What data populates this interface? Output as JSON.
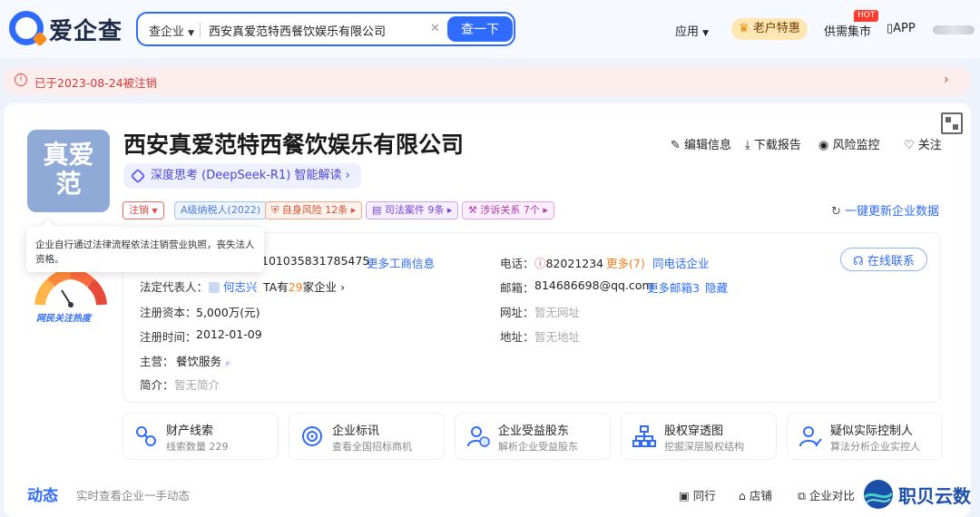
{
  "header": {
    "logo_text": "爱企查",
    "search_type": "查企业",
    "search_value": "西安真爱范特西餐饮娱乐有限公司",
    "search_button": "查一下",
    "nav": {
      "apps": "应用",
      "vip": "老户特惠",
      "market": "供需集市",
      "hot_badge": "HOT",
      "app": "APP"
    }
  },
  "notice": {
    "text": "已于2023-08-24被注销"
  },
  "company": {
    "logo_text": "真爱范",
    "name": "西安真爱范特西餐饮娱乐有限公司",
    "ai_label": "深度思考 (DeepSeek-R1) 智能解读",
    "actions": {
      "edit": "编辑信息",
      "download": "下载报告",
      "monitor": "风险监控",
      "follow": "关注"
    },
    "tags": {
      "status": "注销",
      "tax": "A级纳税人(2022)",
      "risk": "自身风险 12条",
      "judicial": "司法案件 9条",
      "litigation": "涉诉关系 7个"
    },
    "refresh": "一键更新企业数据",
    "tooltip": "企业自行通过法律流程依法注销营业执照，丧失法人资格。"
  },
  "info": {
    "credit_code_partial": "101035831785475",
    "more_business": "更多工商信息",
    "legal_label": "法定代表人：",
    "legal_name": "何志兴",
    "legal_has": "TA有",
    "legal_count": "29",
    "legal_suffix": "家企业",
    "capital_label": "注册资本：",
    "capital_value": "5,000万(元)",
    "date_label": "注册时间：",
    "date_value": "2012-01-09",
    "main_label": "主营：",
    "main_value": "餐饮服务",
    "intro_label": "简介：",
    "intro_value": "暂无简介",
    "phone_label": "电话：",
    "phone_value": "82021234",
    "phone_more": "更多(7)",
    "phone_same": "同电话企业",
    "email_label": "邮箱：",
    "email_value": "814686698@qq.com",
    "email_more": "更多邮箱3",
    "email_hide": "隐藏",
    "website_label": "网址：",
    "website_value": "暂无网址",
    "address_label": "地址：",
    "address_value": "暂无地址",
    "contact_button": "在线联系",
    "gauge_label": "网民关注热度"
  },
  "features": [
    {
      "title": "财产线索",
      "sub": "线索数量 229"
    },
    {
      "title": "企业标讯",
      "sub": "查看全国招标商机"
    },
    {
      "title": "企业受益股东",
      "sub": "解析企业受益股东"
    },
    {
      "title": "股权穿透图",
      "sub": "挖掘深层股权结构"
    },
    {
      "title": "疑似实际控制人",
      "sub": "算法分析企业实控人"
    }
  ],
  "bottom": {
    "title": "动态",
    "sub": "实时查看企业一手动态",
    "peer": "同行",
    "store": "店铺",
    "compare": "企业对比"
  },
  "watermark": {
    "text": "职贝云数"
  },
  "colors": {
    "accent": "#2f6bff",
    "danger": "#e24a4a",
    "orange": "#ff7a1a"
  }
}
